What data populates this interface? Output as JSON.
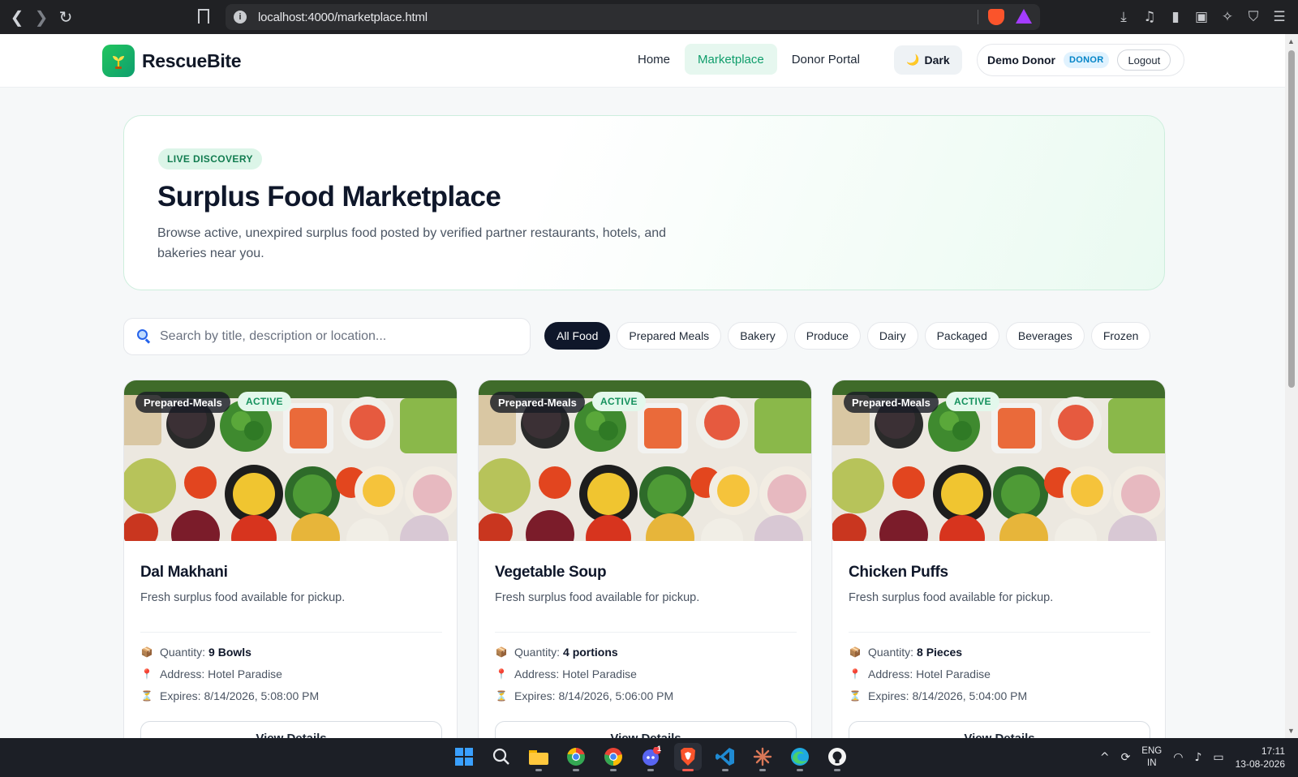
{
  "browser": {
    "url": "localhost:4000/marketplace.html",
    "nav": {
      "back": "❮",
      "forward": "❯",
      "reload": "↻"
    }
  },
  "header": {
    "brand": "RescueBite",
    "nav": [
      {
        "label": "Home",
        "active": false
      },
      {
        "label": "Marketplace",
        "active": true
      },
      {
        "label": "Donor Portal",
        "active": false
      }
    ],
    "theme_toggle": "Dark",
    "user_name": "Demo Donor",
    "role": "DONOR",
    "logout": "Logout"
  },
  "hero": {
    "badge": "LIVE DISCOVERY",
    "title": "Surplus Food Marketplace",
    "description": "Browse active, unexpired surplus food posted by verified partner restaurants, hotels, and bakeries near you."
  },
  "search": {
    "placeholder": "Search by title, description or location..."
  },
  "filters": [
    "All Food",
    "Prepared Meals",
    "Bakery",
    "Produce",
    "Dairy",
    "Packaged",
    "Beverages",
    "Frozen"
  ],
  "active_filter": "All Food",
  "cards": [
    {
      "category": "Prepared-Meals",
      "status": "ACTIVE",
      "title": "Dal Makhani",
      "description": "Fresh surplus food available for pickup.",
      "quantity_label": "Quantity:",
      "quantity": "9 Bowls",
      "address": "Address: Hotel Paradise",
      "expires": "Expires: 8/14/2026, 5:08:00 PM",
      "button": "View Details"
    },
    {
      "category": "Prepared-Meals",
      "status": "ACTIVE",
      "title": "Vegetable Soup",
      "description": "Fresh surplus food available for pickup.",
      "quantity_label": "Quantity:",
      "quantity": "4 portions",
      "address": "Address: Hotel Paradise",
      "expires": "Expires: 8/14/2026, 5:06:00 PM",
      "button": "View Details"
    },
    {
      "category": "Prepared-Meals",
      "status": "ACTIVE",
      "title": "Chicken Puffs",
      "description": "Fresh surplus food available for pickup.",
      "quantity_label": "Quantity:",
      "quantity": "8 Pieces",
      "address": "Address: Hotel Paradise",
      "expires": "Expires: 8/14/2026, 5:04:00 PM",
      "button": "View Details"
    }
  ],
  "taskbar": {
    "lang_top": "ENG",
    "lang_bottom": "IN",
    "time": "17:11",
    "date": "13-08-2026",
    "discord_badge": "1"
  },
  "icons": {
    "moon": "🌙",
    "package": "📦",
    "pin": "📍",
    "hourglass": "⏳"
  },
  "colors": {
    "accent": "#0f9d6b",
    "accent_bg": "#e6f7ef",
    "dark": "#0f172a",
    "role": "#0284c7"
  }
}
